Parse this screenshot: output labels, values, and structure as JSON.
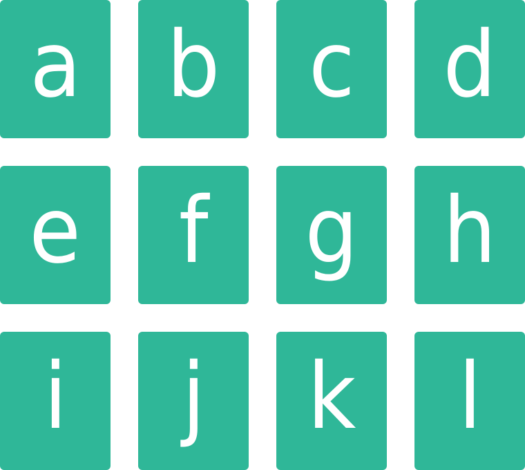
{
  "tile_color": "#2fb798",
  "letter_color": "#ffffff",
  "tiles": [
    {
      "label": "a"
    },
    {
      "label": "b"
    },
    {
      "label": "c"
    },
    {
      "label": "d"
    },
    {
      "label": "e"
    },
    {
      "label": "f"
    },
    {
      "label": "g"
    },
    {
      "label": "h"
    },
    {
      "label": "i"
    },
    {
      "label": "j"
    },
    {
      "label": "k"
    },
    {
      "label": "l"
    }
  ]
}
